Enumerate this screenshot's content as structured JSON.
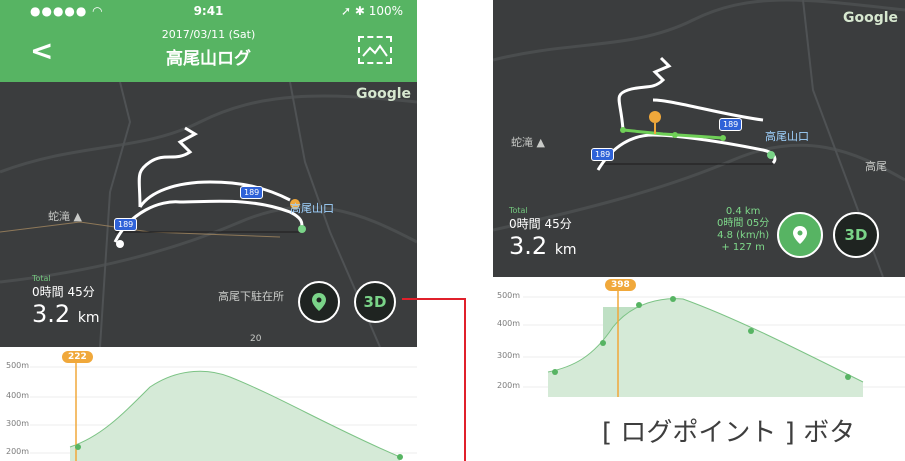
{
  "left_screen": {
    "status": {
      "dots": "●●●●● ◠",
      "time": "9:41",
      "battery": "➚ ✱ 100%"
    },
    "header": {
      "back": "<",
      "date": "2017/03/11 (Sat)",
      "title": "高尾山ログ"
    },
    "map": {
      "google": "Google",
      "place1": "蛇滝 ▲",
      "road1": "189",
      "road2": "189",
      "station": "高尾山口",
      "place2": "高尾下駐在所",
      "road_small": "20"
    },
    "total": {
      "label": "Total",
      "time": "0時間 45分",
      "distance": "3.2",
      "unit": "km"
    },
    "buttons": {
      "pin": "location-pin",
      "three_d": "3D"
    },
    "elevation": {
      "marker": "222",
      "ticks": [
        "500m",
        "400m",
        "300m",
        "200m"
      ]
    }
  },
  "right_screen": {
    "map": {
      "google": "Google",
      "place1": "蛇滝 ▲",
      "road1": "189",
      "road2": "189",
      "station": "高尾山口",
      "place2": "高尾"
    },
    "total": {
      "label": "Total",
      "time": "0時間 45分",
      "distance": "3.2",
      "unit": "km"
    },
    "segment": {
      "distance": "0.4 km",
      "duration": "0時間 05分",
      "speed": "4.8 (km/h)",
      "gain": "+ 127 m"
    },
    "buttons": {
      "three_d": "3D"
    },
    "elevation": {
      "marker": "398",
      "ticks": [
        "500m",
        "400m",
        "300m",
        "200m"
      ]
    }
  },
  "caption": "[ ログポイント ] ボタ",
  "colors": {
    "header": "#57b463",
    "map": "#3b3d3e",
    "accent_red": "#e0202b",
    "marker": "#f0a83b"
  }
}
